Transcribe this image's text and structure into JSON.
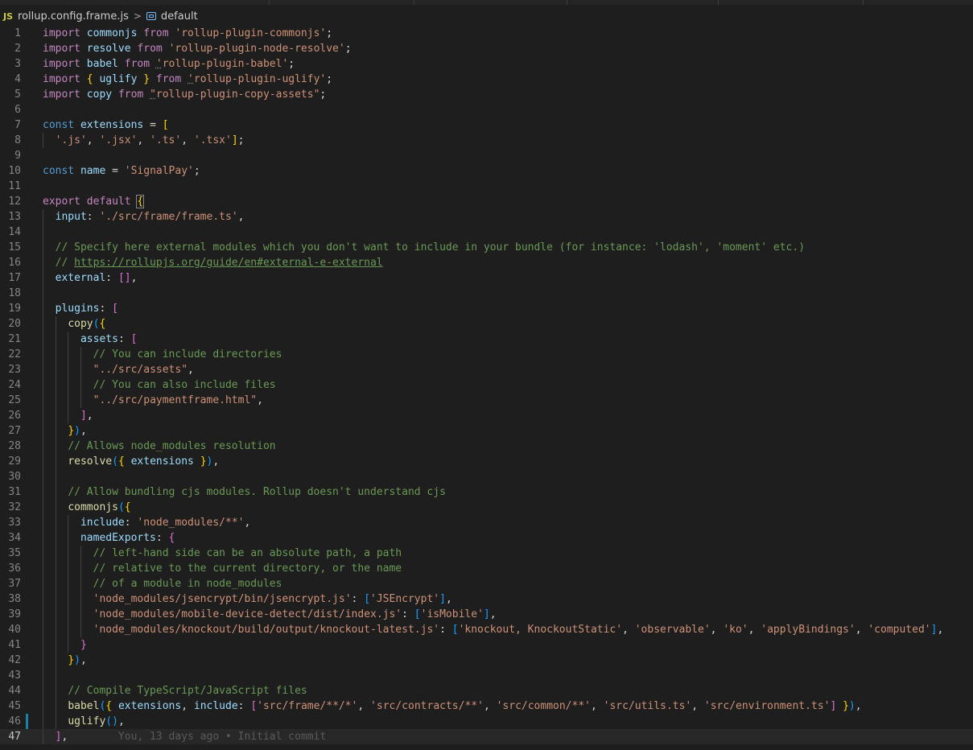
{
  "breadcrumb": {
    "file_icon": "JS",
    "file_name": "rollup.config.frame.js",
    "separator": ">",
    "symbol_icon": "symbol-variable-icon",
    "symbol_name": "default"
  },
  "colors": {
    "background": "#1e1e1e",
    "keyword": "#c586c0",
    "storage": "#569cd6",
    "variable": "#9cdcfe",
    "string": "#ce9178",
    "comment": "#6a9955",
    "function": "#dcdcaa",
    "bracket_level1": "#ffd700",
    "bracket_level2": "#da70d6",
    "bracket_level3": "#179fff",
    "modified_gutter": "#1b81a8"
  },
  "editor": {
    "current_line": 47,
    "modified_line": 46,
    "blame": "You, 13 days ago • Initial commit",
    "lines": [
      {
        "n": 1,
        "indent": 0,
        "tokens": [
          [
            "kw",
            "import"
          ],
          [
            "p",
            " "
          ],
          [
            "var",
            "commonjs"
          ],
          [
            "p",
            " "
          ],
          [
            "kw",
            "from"
          ],
          [
            "p",
            " "
          ],
          [
            "str",
            "'rollup-plugin-commonjs'"
          ],
          [
            "p",
            ";"
          ]
        ]
      },
      {
        "n": 2,
        "indent": 0,
        "tokens": [
          [
            "kw",
            "import"
          ],
          [
            "p",
            " "
          ],
          [
            "var",
            "resolve"
          ],
          [
            "p",
            " "
          ],
          [
            "kw",
            "from"
          ],
          [
            "p",
            " "
          ],
          [
            "str",
            "'rollup-plugin-node-resolve'"
          ],
          [
            "p",
            ";"
          ]
        ]
      },
      {
        "n": 3,
        "indent": 0,
        "tokens": [
          [
            "kw",
            "import"
          ],
          [
            "p",
            " "
          ],
          [
            "var",
            "babel"
          ],
          [
            "p",
            " "
          ],
          [
            "kw",
            "from"
          ],
          [
            "p",
            " "
          ],
          [
            "str dots",
            "'"
          ],
          [
            "str",
            "rollup-plugin-babel'"
          ],
          [
            "p",
            ";"
          ]
        ]
      },
      {
        "n": 4,
        "indent": 0,
        "tokens": [
          [
            "kw",
            "import"
          ],
          [
            "p",
            " "
          ],
          [
            "b1",
            "{"
          ],
          [
            "p",
            " "
          ],
          [
            "var",
            "uglify"
          ],
          [
            "p",
            " "
          ],
          [
            "b1",
            "}"
          ],
          [
            "p",
            " "
          ],
          [
            "kw",
            "from"
          ],
          [
            "p",
            " "
          ],
          [
            "str dots",
            "'"
          ],
          [
            "str",
            "rollup-plugin-uglify'"
          ],
          [
            "p",
            ";"
          ]
        ]
      },
      {
        "n": 5,
        "indent": 0,
        "tokens": [
          [
            "kw",
            "import"
          ],
          [
            "p",
            " "
          ],
          [
            "var",
            "copy"
          ],
          [
            "p",
            " "
          ],
          [
            "kw",
            "from"
          ],
          [
            "p",
            " "
          ],
          [
            "str dots",
            "\""
          ],
          [
            "str",
            "rollup-plugin-copy-assets\""
          ],
          [
            "p",
            ";"
          ]
        ]
      },
      {
        "n": 6,
        "indent": 0,
        "tokens": []
      },
      {
        "n": 7,
        "indent": 0,
        "tokens": [
          [
            "st",
            "const"
          ],
          [
            "p",
            " "
          ],
          [
            "var",
            "extensions"
          ],
          [
            "p",
            " = "
          ],
          [
            "b1",
            "["
          ]
        ]
      },
      {
        "n": 8,
        "indent": 1,
        "tokens": [
          [
            "p",
            "  "
          ],
          [
            "str",
            "'.js'"
          ],
          [
            "p",
            ", "
          ],
          [
            "str",
            "'.jsx'"
          ],
          [
            "p",
            ", "
          ],
          [
            "str",
            "'.ts'"
          ],
          [
            "p",
            ", "
          ],
          [
            "str",
            "'.tsx'"
          ],
          [
            "b1",
            "]"
          ],
          [
            "p",
            ";"
          ]
        ]
      },
      {
        "n": 9,
        "indent": 0,
        "tokens": []
      },
      {
        "n": 10,
        "indent": 0,
        "tokens": [
          [
            "st",
            "const"
          ],
          [
            "p",
            " "
          ],
          [
            "var",
            "name"
          ],
          [
            "p",
            " = "
          ],
          [
            "str",
            "'SignalPay'"
          ],
          [
            "p",
            ";"
          ]
        ]
      },
      {
        "n": 11,
        "indent": 0,
        "tokens": []
      },
      {
        "n": 12,
        "indent": 0,
        "tokens": [
          [
            "kw",
            "export"
          ],
          [
            "p",
            " "
          ],
          [
            "kw",
            "default"
          ],
          [
            "p",
            " "
          ],
          [
            "b1 bbox",
            "{"
          ]
        ]
      },
      {
        "n": 13,
        "indent": 1,
        "tokens": [
          [
            "p",
            "  "
          ],
          [
            "var",
            "input"
          ],
          [
            "p",
            ": "
          ],
          [
            "str",
            "'./src/frame/frame.ts'"
          ],
          [
            "p",
            ","
          ]
        ]
      },
      {
        "n": 14,
        "indent": 1,
        "tokens": []
      },
      {
        "n": 15,
        "indent": 1,
        "tokens": [
          [
            "p",
            "  "
          ],
          [
            "cm",
            "// Specify here external modules which you don't want to include in your bundle (for instance: 'lodash', 'moment' etc.)"
          ]
        ]
      },
      {
        "n": 16,
        "indent": 1,
        "tokens": [
          [
            "p",
            "  "
          ],
          [
            "cm",
            "// "
          ],
          [
            "cm lnk",
            "https://rollupjs.org/guide/en#external-e-external"
          ]
        ]
      },
      {
        "n": 17,
        "indent": 1,
        "tokens": [
          [
            "p",
            "  "
          ],
          [
            "var",
            "external"
          ],
          [
            "p",
            ": "
          ],
          [
            "b2",
            "[]"
          ],
          [
            "p",
            ","
          ]
        ]
      },
      {
        "n": 18,
        "indent": 1,
        "tokens": []
      },
      {
        "n": 19,
        "indent": 1,
        "tokens": [
          [
            "p",
            "  "
          ],
          [
            "var",
            "plugins"
          ],
          [
            "p",
            ": "
          ],
          [
            "b2",
            "["
          ]
        ]
      },
      {
        "n": 20,
        "indent": 2,
        "tokens": [
          [
            "p",
            "    "
          ],
          [
            "fn",
            "copy"
          ],
          [
            "b3",
            "("
          ],
          [
            "b1",
            "{"
          ]
        ]
      },
      {
        "n": 21,
        "indent": 3,
        "tokens": [
          [
            "p",
            "      "
          ],
          [
            "var",
            "assets"
          ],
          [
            "p",
            ": "
          ],
          [
            "b2",
            "["
          ]
        ]
      },
      {
        "n": 22,
        "indent": 4,
        "tokens": [
          [
            "p",
            "        "
          ],
          [
            "cm",
            "// You can include directories"
          ]
        ]
      },
      {
        "n": 23,
        "indent": 4,
        "tokens": [
          [
            "p",
            "        "
          ],
          [
            "str",
            "\"../src/assets\""
          ],
          [
            "p",
            ","
          ]
        ]
      },
      {
        "n": 24,
        "indent": 4,
        "tokens": [
          [
            "p",
            "        "
          ],
          [
            "cm",
            "// You can also include files"
          ]
        ]
      },
      {
        "n": 25,
        "indent": 4,
        "tokens": [
          [
            "p",
            "        "
          ],
          [
            "str",
            "\"../src/paymentframe.html\""
          ],
          [
            "p",
            ","
          ]
        ]
      },
      {
        "n": 26,
        "indent": 3,
        "tokens": [
          [
            "p",
            "      "
          ],
          [
            "b2",
            "]"
          ],
          [
            "p",
            ","
          ]
        ]
      },
      {
        "n": 27,
        "indent": 2,
        "tokens": [
          [
            "p",
            "    "
          ],
          [
            "b1",
            "}"
          ],
          [
            "b3",
            ")"
          ],
          [
            "p",
            ","
          ]
        ]
      },
      {
        "n": 28,
        "indent": 2,
        "tokens": [
          [
            "p",
            "    "
          ],
          [
            "cm",
            "// Allows node_modules resolution"
          ]
        ]
      },
      {
        "n": 29,
        "indent": 2,
        "tokens": [
          [
            "p",
            "    "
          ],
          [
            "fn",
            "resolve"
          ],
          [
            "b3",
            "("
          ],
          [
            "b1",
            "{"
          ],
          [
            "p",
            " "
          ],
          [
            "var",
            "extensions"
          ],
          [
            "p",
            " "
          ],
          [
            "b1",
            "}"
          ],
          [
            "b3",
            ")"
          ],
          [
            "p",
            ","
          ]
        ]
      },
      {
        "n": 30,
        "indent": 2,
        "tokens": []
      },
      {
        "n": 31,
        "indent": 2,
        "tokens": [
          [
            "p",
            "    "
          ],
          [
            "cm",
            "// Allow bundling cjs modules. Rollup doesn't understand cjs"
          ]
        ]
      },
      {
        "n": 32,
        "indent": 2,
        "tokens": [
          [
            "p",
            "    "
          ],
          [
            "fn",
            "commonjs"
          ],
          [
            "b3",
            "("
          ],
          [
            "b1",
            "{"
          ]
        ]
      },
      {
        "n": 33,
        "indent": 3,
        "tokens": [
          [
            "p",
            "      "
          ],
          [
            "var",
            "include"
          ],
          [
            "p",
            ": "
          ],
          [
            "str",
            "'node_modules/**'"
          ],
          [
            "p",
            ","
          ]
        ]
      },
      {
        "n": 34,
        "indent": 3,
        "tokens": [
          [
            "p",
            "      "
          ],
          [
            "var",
            "namedExports"
          ],
          [
            "p",
            ": "
          ],
          [
            "b2",
            "{"
          ]
        ]
      },
      {
        "n": 35,
        "indent": 4,
        "tokens": [
          [
            "p",
            "        "
          ],
          [
            "cm",
            "// left-hand side can be an absolute path, a path"
          ]
        ]
      },
      {
        "n": 36,
        "indent": 4,
        "tokens": [
          [
            "p",
            "        "
          ],
          [
            "cm",
            "// relative to the current directory, or the name"
          ]
        ]
      },
      {
        "n": 37,
        "indent": 4,
        "tokens": [
          [
            "p",
            "        "
          ],
          [
            "cm",
            "// of a module in node_modules"
          ]
        ]
      },
      {
        "n": 38,
        "indent": 4,
        "tokens": [
          [
            "p",
            "        "
          ],
          [
            "str",
            "'node_modules/jsencrypt/bin/jsencrypt.js'"
          ],
          [
            "p",
            ": "
          ],
          [
            "b3",
            "["
          ],
          [
            "str",
            "'JSEncrypt'"
          ],
          [
            "b3",
            "]"
          ],
          [
            "p",
            ","
          ]
        ]
      },
      {
        "n": 39,
        "indent": 4,
        "tokens": [
          [
            "p",
            "        "
          ],
          [
            "str",
            "'node_modules/mobile-device-detect/dist/index.js'"
          ],
          [
            "p",
            ": "
          ],
          [
            "b3",
            "["
          ],
          [
            "str",
            "'isMobile'"
          ],
          [
            "b3",
            "]"
          ],
          [
            "p",
            ","
          ]
        ]
      },
      {
        "n": 40,
        "indent": 4,
        "tokens": [
          [
            "p",
            "        "
          ],
          [
            "str",
            "'node_modules/knockout/build/output/knockout-latest.js'"
          ],
          [
            "p",
            ": "
          ],
          [
            "b3",
            "["
          ],
          [
            "str",
            "'knockout, KnockoutStatic'"
          ],
          [
            "p",
            ", "
          ],
          [
            "str",
            "'observable'"
          ],
          [
            "p",
            ", "
          ],
          [
            "str",
            "'ko'"
          ],
          [
            "p",
            ", "
          ],
          [
            "str",
            "'applyBindings'"
          ],
          [
            "p",
            ", "
          ],
          [
            "str",
            "'computed'"
          ],
          [
            "b3",
            "]"
          ],
          [
            "p",
            ","
          ]
        ]
      },
      {
        "n": 41,
        "indent": 3,
        "tokens": [
          [
            "p",
            "      "
          ],
          [
            "b2",
            "}"
          ]
        ]
      },
      {
        "n": 42,
        "indent": 2,
        "tokens": [
          [
            "p",
            "    "
          ],
          [
            "b1",
            "}"
          ],
          [
            "b3",
            ")"
          ],
          [
            "p",
            ","
          ]
        ]
      },
      {
        "n": 43,
        "indent": 2,
        "tokens": []
      },
      {
        "n": 44,
        "indent": 2,
        "tokens": [
          [
            "p",
            "    "
          ],
          [
            "cm",
            "// Compile TypeScript/JavaScript files"
          ]
        ]
      },
      {
        "n": 45,
        "indent": 2,
        "tokens": [
          [
            "p",
            "    "
          ],
          [
            "fn",
            "babel"
          ],
          [
            "b3",
            "("
          ],
          [
            "b1",
            "{"
          ],
          [
            "p",
            " "
          ],
          [
            "var",
            "extensions"
          ],
          [
            "p",
            ", "
          ],
          [
            "var",
            "include"
          ],
          [
            "p",
            ": "
          ],
          [
            "b2",
            "["
          ],
          [
            "str",
            "'src/frame/**/*'"
          ],
          [
            "p",
            ", "
          ],
          [
            "str",
            "'src/contracts/**'"
          ],
          [
            "p",
            ", "
          ],
          [
            "str",
            "'src/common/**'"
          ],
          [
            "p",
            ", "
          ],
          [
            "str",
            "'src/utils.ts'"
          ],
          [
            "p",
            ", "
          ],
          [
            "str",
            "'src/environment.ts'"
          ],
          [
            "b2",
            "]"
          ],
          [
            "p",
            " "
          ],
          [
            "b1",
            "}"
          ],
          [
            "b3",
            ")"
          ],
          [
            "p",
            ","
          ]
        ]
      },
      {
        "n": 46,
        "indent": 2,
        "tokens": [
          [
            "p",
            "    "
          ],
          [
            "fn",
            "uglify"
          ],
          [
            "b3",
            "()"
          ],
          [
            "p",
            ","
          ]
        ]
      },
      {
        "n": 47,
        "indent": 1,
        "tokens": [
          [
            "p",
            "  "
          ],
          [
            "b2",
            "]"
          ],
          [
            "p",
            ","
          ]
        ]
      }
    ]
  }
}
